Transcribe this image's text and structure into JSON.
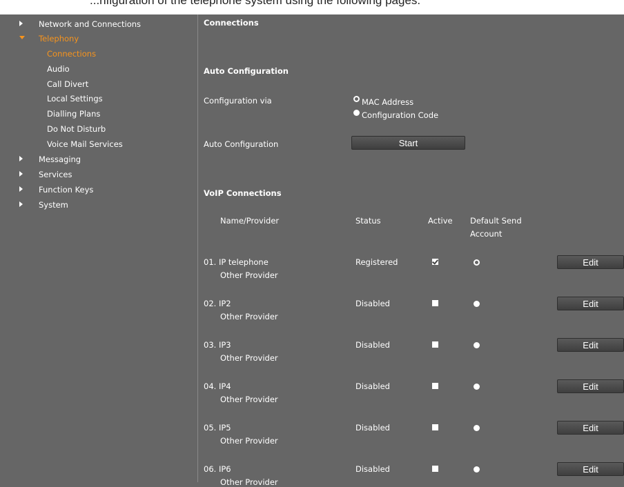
{
  "header": {
    "top_text": "...nfiguration of the telephone system using the following pages."
  },
  "sidebar": {
    "items": [
      {
        "label": "Network and Connections"
      },
      {
        "label": "Telephony"
      },
      {
        "label": "Connections"
      },
      {
        "label": "Audio"
      },
      {
        "label": "Call Divert"
      },
      {
        "label": "Local Settings"
      },
      {
        "label": "Dialling Plans"
      },
      {
        "label": "Do Not Disturb"
      },
      {
        "label": "Voice Mail Services"
      },
      {
        "label": "Messaging"
      },
      {
        "label": "Services"
      },
      {
        "label": "Function Keys"
      },
      {
        "label": "System"
      }
    ]
  },
  "main": {
    "page_title": "Connections",
    "auto_config": {
      "heading": "Auto Configuration",
      "config_via_label": "Configuration via",
      "options": [
        "MAC Address",
        "Configuration Code"
      ],
      "selected": "MAC Address",
      "auto_label": "Auto Configuration",
      "start_button": "Start"
    },
    "voip": {
      "heading": "VoIP Connections",
      "columns": {
        "name": "Name/Provider",
        "status": "Status",
        "active": "Active",
        "default1": "Default Send",
        "default2": "Account"
      },
      "edit_label": "Edit",
      "rows": [
        {
          "name": "01. IP telephone",
          "provider": "Other Provider",
          "status": "Registered",
          "active": true,
          "default": true
        },
        {
          "name": "02. IP2",
          "provider": "Other Provider",
          "status": "Disabled",
          "active": false,
          "default": false
        },
        {
          "name": "03. IP3",
          "provider": "Other Provider",
          "status": "Disabled",
          "active": false,
          "default": false
        },
        {
          "name": "04. IP4",
          "provider": "Other Provider",
          "status": "Disabled",
          "active": false,
          "default": false
        },
        {
          "name": "05. IP5",
          "provider": "Other Provider",
          "status": "Disabled",
          "active": false,
          "default": false
        },
        {
          "name": "06. IP6",
          "provider": "Other Provider",
          "status": "Disabled",
          "active": false,
          "default": false
        }
      ]
    }
  },
  "colors": {
    "background": "#666666",
    "accent": "#f7941d",
    "text": "#ffffff"
  }
}
